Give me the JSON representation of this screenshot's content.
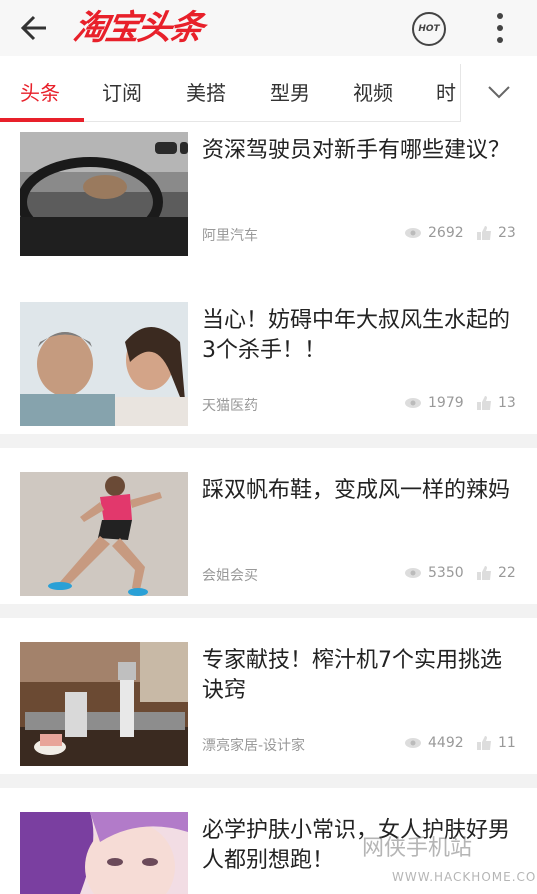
{
  "header": {
    "logo_text": "淘宝头条",
    "hot_label": "HOT"
  },
  "tabs": [
    {
      "label": "头条",
      "active": true
    },
    {
      "label": "订阅",
      "active": false
    },
    {
      "label": "美搭",
      "active": false
    },
    {
      "label": "型男",
      "active": false
    },
    {
      "label": "视频",
      "active": false
    },
    {
      "label": "时",
      "active": false
    }
  ],
  "articles": [
    {
      "title": "资深驾驶员对新手有哪些建议？",
      "source": "阿里汽车",
      "views": "2692",
      "likes": "23",
      "thumb": "car-interior"
    },
    {
      "title": "当心！妨碍中年大叔风生水起的3个杀手！！",
      "source": "天猫医药",
      "views": "1979",
      "likes": "13",
      "thumb": "couple-smiling"
    },
    {
      "title": "踩双帆布鞋，变成风一样的辣妈",
      "source": "会姐会买",
      "views": "5350",
      "likes": "22",
      "thumb": "woman-running"
    },
    {
      "title": "专家献技！榨汁机7个实用挑选诀窍",
      "source": "漂亮家居-设计家",
      "views": "4492",
      "likes": "11",
      "thumb": "kitchen-appliances"
    },
    {
      "title": "必学护肤小常识，女人护肤好男人都别想跑！",
      "source": "",
      "views": "",
      "likes": "",
      "thumb": "woman-purple-hair"
    }
  ],
  "watermark": {
    "line1": "网侠手机站",
    "line2": "WWW.HACKHOME.COM"
  },
  "colors": {
    "accent": "#e8202a",
    "meta": "#999999",
    "separator": "#f2f2f2"
  }
}
